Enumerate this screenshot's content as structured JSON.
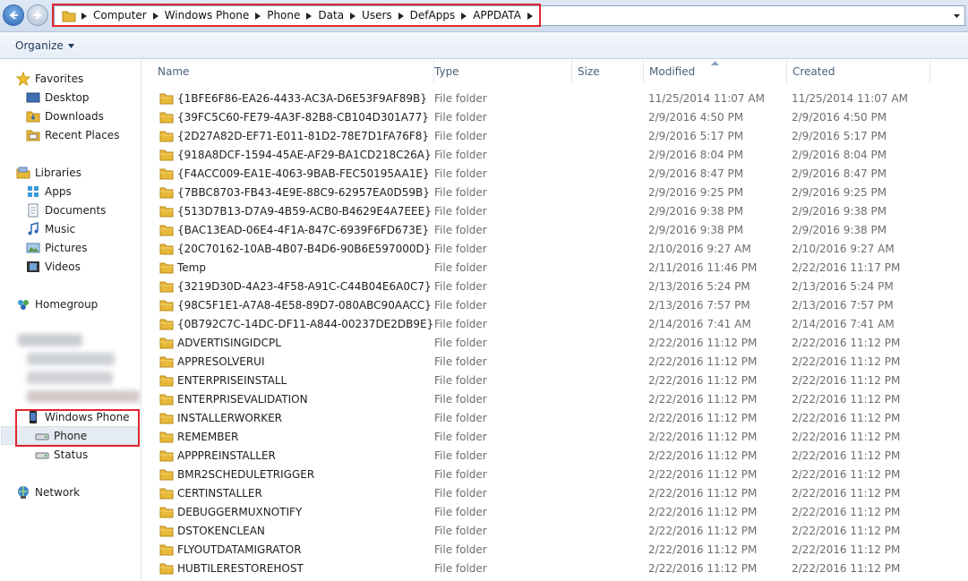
{
  "address": {
    "crumbs": [
      "Computer",
      "Windows Phone",
      "Phone",
      "Data",
      "Users",
      "DefApps",
      "APPDATA"
    ]
  },
  "toolbar": {
    "organize_label": "Organize"
  },
  "navigation": {
    "favorites": {
      "label": "Favorites",
      "items": [
        "Desktop",
        "Downloads",
        "Recent Places"
      ]
    },
    "libraries": {
      "label": "Libraries",
      "items": [
        "Apps",
        "Documents",
        "Music",
        "Pictures",
        "Videos"
      ]
    },
    "homegroup": "Homegroup",
    "computer": {
      "windows_phone": "Windows Phone",
      "phone": "Phone",
      "status": "Status"
    },
    "network": "Network"
  },
  "columns": {
    "name": "Name",
    "type": "Type",
    "size": "Size",
    "modified": "Modified",
    "created": "Created"
  },
  "files": [
    {
      "name": "{1BFE6F86-EA26-4433-AC3A-D6E53F9AF89B}",
      "type": "File folder",
      "modified": "11/25/2014 11:07 AM",
      "created": "11/25/2014 11:07 AM"
    },
    {
      "name": "{39FC5C60-FE79-4A3F-82B8-CB104D301A77}",
      "type": "File folder",
      "modified": "2/9/2016 4:50 PM",
      "created": "2/9/2016 4:50 PM"
    },
    {
      "name": "{2D27A82D-EF71-E011-81D2-78E7D1FA76F8}",
      "type": "File folder",
      "modified": "2/9/2016 5:17 PM",
      "created": "2/9/2016 5:17 PM"
    },
    {
      "name": "{918A8DCF-1594-45AE-AF29-BA1CD218C26A}",
      "type": "File folder",
      "modified": "2/9/2016 8:04 PM",
      "created": "2/9/2016 8:04 PM"
    },
    {
      "name": "{F4ACC009-EA1E-4063-9BAB-FEC50195AA1E}",
      "type": "File folder",
      "modified": "2/9/2016 8:47 PM",
      "created": "2/9/2016 8:47 PM"
    },
    {
      "name": "{7BBC8703-FB43-4E9E-88C9-62957EA0D59B}",
      "type": "File folder",
      "modified": "2/9/2016 9:25 PM",
      "created": "2/9/2016 9:25 PM"
    },
    {
      "name": "{513D7B13-D7A9-4B59-ACB0-B4629E4A7EEE}",
      "type": "File folder",
      "modified": "2/9/2016 9:38 PM",
      "created": "2/9/2016 9:38 PM"
    },
    {
      "name": "{BAC13EAD-06E4-4F1A-847C-6939F6FD673E}",
      "type": "File folder",
      "modified": "2/9/2016 9:38 PM",
      "created": "2/9/2016 9:38 PM"
    },
    {
      "name": "{20C70162-10AB-4B07-B4D6-90B6E597000D}",
      "type": "File folder",
      "modified": "2/10/2016 9:27 AM",
      "created": "2/10/2016 9:27 AM"
    },
    {
      "name": "Temp",
      "type": "File folder",
      "modified": "2/11/2016 11:46 PM",
      "created": "2/22/2016 11:17 PM"
    },
    {
      "name": "{3219D30D-4A23-4F58-A91C-C44B04E6A0C7}",
      "type": "File folder",
      "modified": "2/13/2016 5:24 PM",
      "created": "2/13/2016 5:24 PM"
    },
    {
      "name": "{98C5F1E1-A7A8-4E58-89D7-080ABC90AACC}",
      "type": "File folder",
      "modified": "2/13/2016 7:57 PM",
      "created": "2/13/2016 7:57 PM"
    },
    {
      "name": "{0B792C7C-14DC-DF11-A844-00237DE2DB9E}",
      "type": "File folder",
      "modified": "2/14/2016 7:41 AM",
      "created": "2/14/2016 7:41 AM"
    },
    {
      "name": "ADVERTISINGIDCPL",
      "type": "File folder",
      "modified": "2/22/2016 11:12 PM",
      "created": "2/22/2016 11:12 PM"
    },
    {
      "name": "APPRESOLVERUI",
      "type": "File folder",
      "modified": "2/22/2016 11:12 PM",
      "created": "2/22/2016 11:12 PM"
    },
    {
      "name": "ENTERPRISEINSTALL",
      "type": "File folder",
      "modified": "2/22/2016 11:12 PM",
      "created": "2/22/2016 11:12 PM"
    },
    {
      "name": "ENTERPRISEVALIDATION",
      "type": "File folder",
      "modified": "2/22/2016 11:12 PM",
      "created": "2/22/2016 11:12 PM"
    },
    {
      "name": "INSTALLERWORKER",
      "type": "File folder",
      "modified": "2/22/2016 11:12 PM",
      "created": "2/22/2016 11:12 PM"
    },
    {
      "name": "REMEMBER",
      "type": "File folder",
      "modified": "2/22/2016 11:12 PM",
      "created": "2/22/2016 11:12 PM"
    },
    {
      "name": "APPPREINSTALLER",
      "type": "File folder",
      "modified": "2/22/2016 11:12 PM",
      "created": "2/22/2016 11:12 PM"
    },
    {
      "name": "BMR2SCHEDULETRIGGER",
      "type": "File folder",
      "modified": "2/22/2016 11:12 PM",
      "created": "2/22/2016 11:12 PM"
    },
    {
      "name": "CERTINSTALLER",
      "type": "File folder",
      "modified": "2/22/2016 11:12 PM",
      "created": "2/22/2016 11:12 PM"
    },
    {
      "name": "DEBUGGERMUXNOTIFY",
      "type": "File folder",
      "modified": "2/22/2016 11:12 PM",
      "created": "2/22/2016 11:12 PM"
    },
    {
      "name": "DSTOKENCLEAN",
      "type": "File folder",
      "modified": "2/22/2016 11:12 PM",
      "created": "2/22/2016 11:12 PM"
    },
    {
      "name": "FLYOUTDATAMIGRATOR",
      "type": "File folder",
      "modified": "2/22/2016 11:12 PM",
      "created": "2/22/2016 11:12 PM"
    },
    {
      "name": "HUBTILERESTOREHOST",
      "type": "File folder",
      "modified": "2/22/2016 11:12 PM",
      "created": "2/22/2016 11:12 PM"
    }
  ],
  "colors": {
    "highlight": "#e0262d",
    "folder": "#e8b838",
    "header_text": "#4c607a"
  }
}
